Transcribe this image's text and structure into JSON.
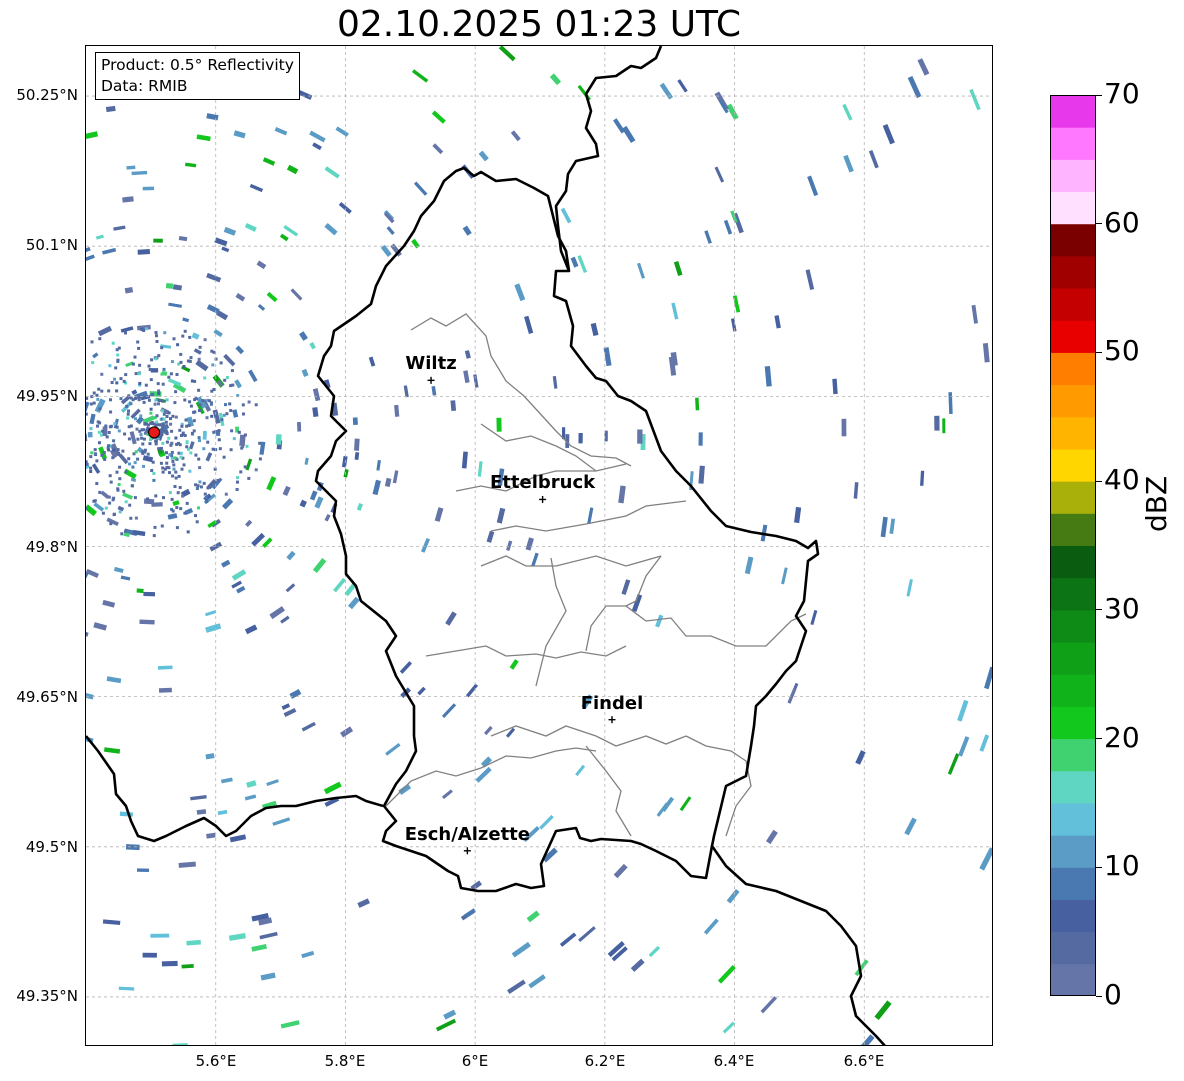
{
  "title": "02.10.2025 01:23 UTC",
  "info_box": {
    "product": "Product: 0.5° Reflectivity",
    "source": "Data: RMIB"
  },
  "lat_labels": [
    "50.25°N",
    "50.1°N",
    "49.95°N",
    "49.8°N",
    "49.65°N",
    "49.5°N",
    "49.35°N"
  ],
  "lon_labels": [
    "5.6°E",
    "5.8°E",
    "6°E",
    "6.2°E",
    "6.4°E",
    "6.6°E"
  ],
  "cities": [
    {
      "name": "Wiltz",
      "lat": 49.966,
      "lon": 5.932
    },
    {
      "name": "Ettelbruck",
      "lat": 49.847,
      "lon": 6.104
    },
    {
      "name": "Findel",
      "lat": 49.627,
      "lon": 6.211
    },
    {
      "name": "Esch/Alzette",
      "lat": 49.496,
      "lon": 5.988
    }
  ],
  "radar_site": {
    "lat": 49.914,
    "lon": 5.505,
    "color": "#e8191b"
  },
  "map_extent": {
    "lon_min": 5.4,
    "lon_max": 6.8,
    "lat_min": 49.3,
    "lat_max": 50.3
  },
  "colorbar": {
    "label": "dBZ",
    "min": 0,
    "max": 70,
    "ticks": [
      "0",
      "10",
      "20",
      "30",
      "40",
      "50",
      "60",
      "70"
    ],
    "colors": [
      "#6675a8",
      "#546aa0",
      "#4660a0",
      "#4a78b0",
      "#5a9cc6",
      "#62c0da",
      "#5ed6c2",
      "#40d270",
      "#12c81c",
      "#10b41a",
      "#10a018",
      "#0e8a16",
      "#0c7414",
      "#0a5c10",
      "#467a12",
      "#aab00a",
      "#ffd600",
      "#ffb400",
      "#ff9a00",
      "#ff7e00",
      "#e80000",
      "#c40000",
      "#a00000",
      "#7a0000",
      "#ffe0ff",
      "#ffb4ff",
      "#ff78ff",
      "#e838ec"
    ]
  }
}
